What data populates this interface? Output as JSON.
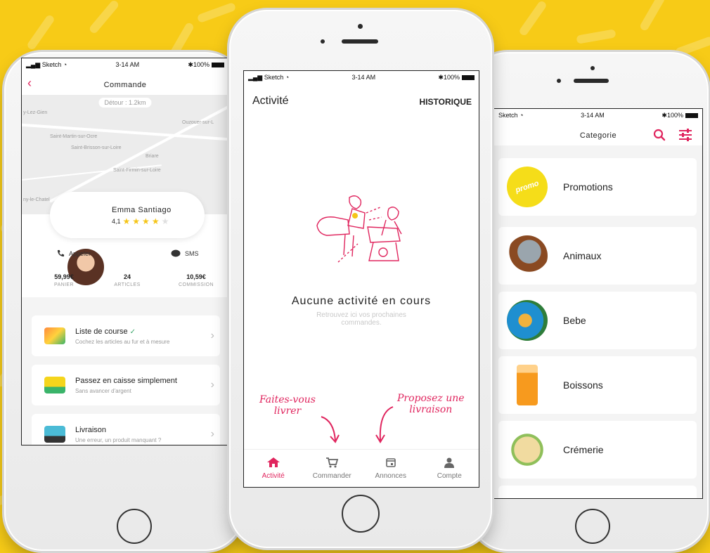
{
  "status": {
    "carrier": "Sketch",
    "time": "3-14 AM",
    "battery": "100%"
  },
  "left": {
    "title": "Commande",
    "detour": "Détour : 1.2km",
    "places": [
      "y-Lez-Gien",
      "Ouzouer-sur-L",
      "Saint-Martin-sur-Ocre",
      "Saint-Brisson-sur-Loire",
      "Briare",
      "Saint-Firmin-sur-Loire",
      "ny-le-Chatel"
    ],
    "name": "Emma Santiago",
    "rating": "4,1",
    "stars": 4,
    "call": "Appeler",
    "sms": "SMS",
    "stats": [
      {
        "value": "59,99€",
        "label": "PANIER"
      },
      {
        "value": "24",
        "label": "ARTICLES"
      },
      {
        "value": "10,59€",
        "label": "COMMISSION"
      }
    ],
    "cards": [
      {
        "title": "Liste de course",
        "subtitle": "Cochez les articles au fur et à mesure"
      },
      {
        "title": "Passez en caisse simplement",
        "subtitle": "Sans avancer d'argent"
      },
      {
        "title": "Livraison",
        "subtitle": "Une erreur, un produit manquant ?"
      }
    ]
  },
  "center": {
    "title": "Activité",
    "history": "HISTORIQUE",
    "empty_title": "Aucune activité en cours",
    "empty_sub_1": "Retrouvez ici vos prochaines",
    "empty_sub_2": "commandes.",
    "tabs": [
      "Activité",
      "Commander",
      "Annonces",
      "Compte"
    ],
    "note_left_1": "Faites-vous",
    "note_left_2": "livrer",
    "note_right_1": "Proposez une",
    "note_right_2": "livraison"
  },
  "right": {
    "title": "Categorie",
    "promo_badge": "promo",
    "categories": [
      "Promotions",
      "Animaux",
      "Bebe",
      "Boissons",
      "Crémerie"
    ]
  },
  "colors": {
    "accent": "#e0255e",
    "background": "#f7cb17",
    "promo": "#f5dd19"
  }
}
